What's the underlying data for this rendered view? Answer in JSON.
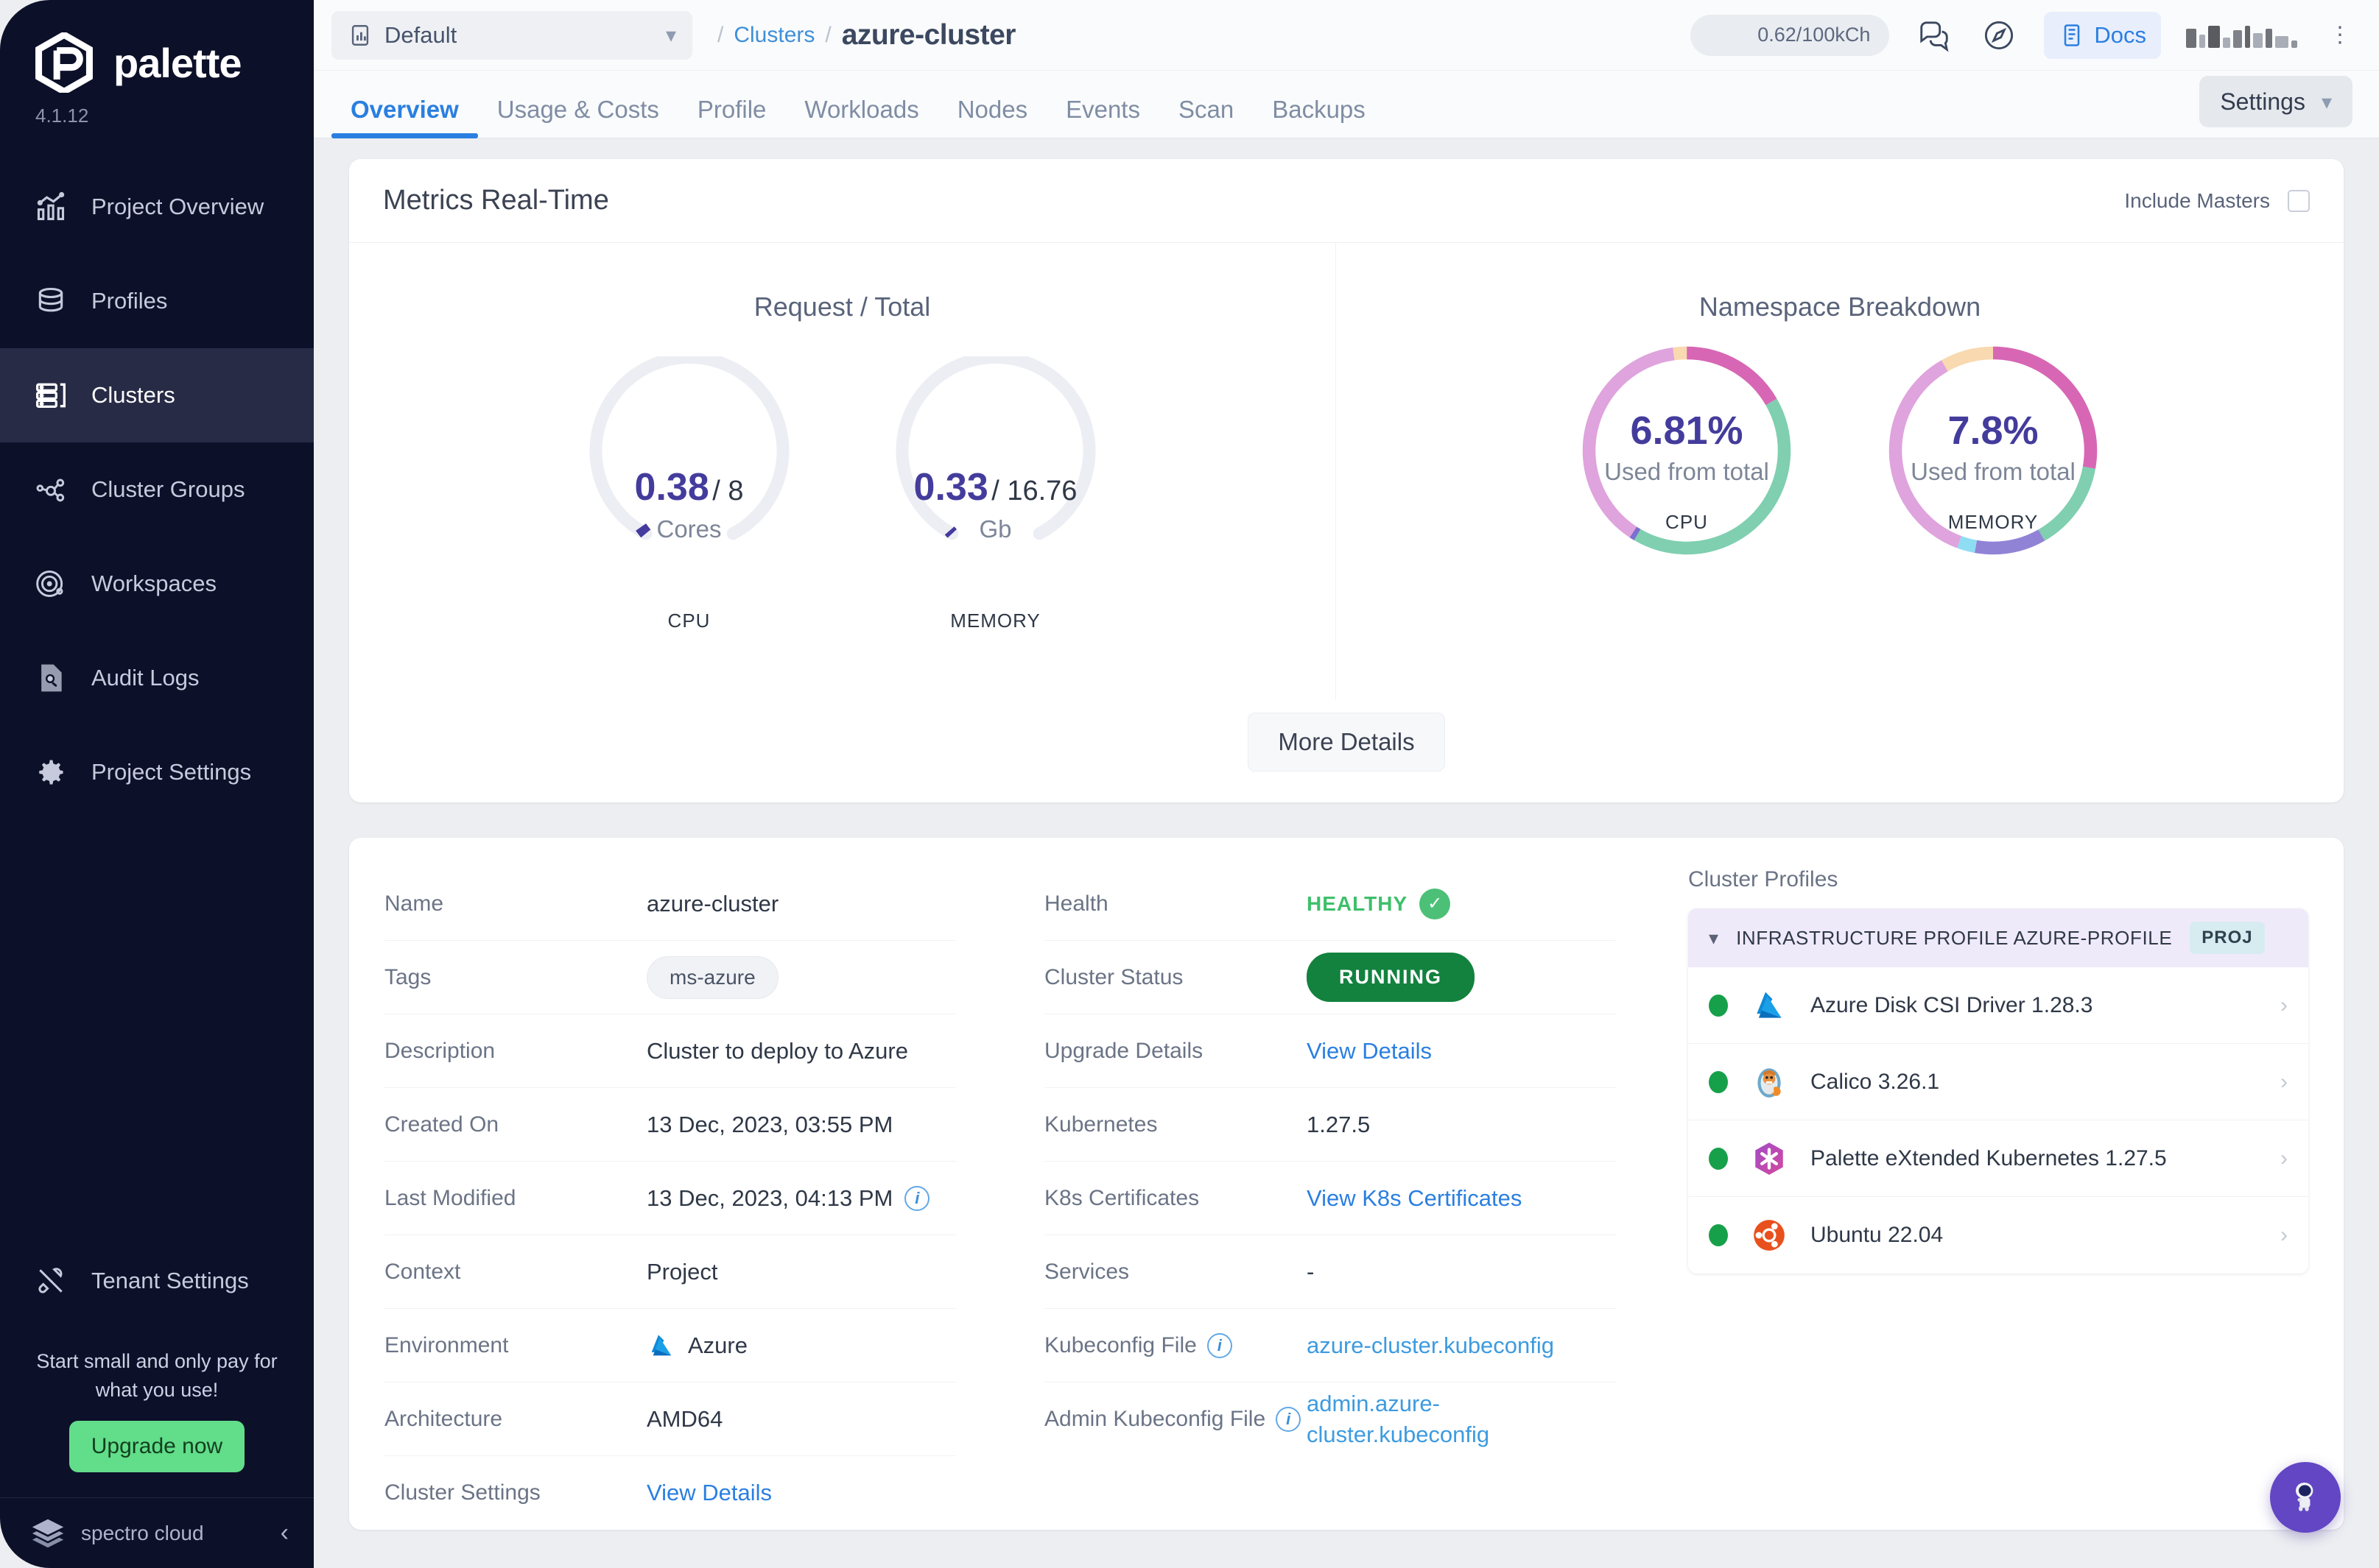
{
  "sidebar": {
    "brand": "palette",
    "version": "4.1.12",
    "items": [
      {
        "label": "Project Overview",
        "icon": "chart-bars-icon"
      },
      {
        "label": "Profiles",
        "icon": "stack-icon"
      },
      {
        "label": "Clusters",
        "icon": "server-rack-icon"
      },
      {
        "label": "Cluster Groups",
        "icon": "nodes-graph-icon"
      },
      {
        "label": "Workspaces",
        "icon": "orbit-icon"
      },
      {
        "label": "Audit Logs",
        "icon": "document-search-icon"
      },
      {
        "label": "Project Settings",
        "icon": "gear-icon"
      }
    ],
    "active_item": "Clusters",
    "tenant_settings": "Tenant Settings",
    "promo_text": "Start small and only pay for what you use!",
    "promo_button": "Upgrade now",
    "footer_brand": "spectro cloud"
  },
  "topbar": {
    "project": "Default",
    "breadcrumb_parent": "Clusters",
    "breadcrumb_current": "azure-cluster",
    "credits": "0.62/100kCh",
    "docs": "Docs"
  },
  "tabs": [
    {
      "label": "Overview",
      "active": true
    },
    {
      "label": "Usage & Costs",
      "active": false
    },
    {
      "label": "Profile",
      "active": false
    },
    {
      "label": "Workloads",
      "active": false
    },
    {
      "label": "Nodes",
      "active": false
    },
    {
      "label": "Events",
      "active": false
    },
    {
      "label": "Scan",
      "active": false
    },
    {
      "label": "Backups",
      "active": false
    }
  ],
  "settings_button": "Settings",
  "metrics": {
    "title": "Metrics Real-Time",
    "include_masters_label": "Include Masters",
    "include_masters_checked": false,
    "left_panel_title": "Request / Total",
    "right_panel_title": "Namespace Breakdown",
    "more_details": "More Details"
  },
  "chart_data": [
    {
      "type": "gauge",
      "title": "Request / Total",
      "id": "cpu-gauge",
      "label": "CPU",
      "unit": "Cores",
      "value": 0.38,
      "total": 8,
      "value_text": "0.38",
      "total_text": "/ 8",
      "fraction": 0.0475,
      "arc_span_degrees": 270,
      "track_color": "#eceef4",
      "fill_color": "#453a9e"
    },
    {
      "type": "gauge",
      "title": "Request / Total",
      "id": "memory-gauge",
      "label": "MEMORY",
      "unit": "Gb",
      "value": 0.33,
      "total": 16.76,
      "value_text": "0.33",
      "total_text": "/ 16.76",
      "fraction": 0.0197,
      "arc_span_degrees": 270,
      "track_color": "#eceef4",
      "fill_color": "#453a9e"
    },
    {
      "type": "pie",
      "title": "Namespace Breakdown",
      "id": "cpu-namespace-donut",
      "label": "CPU",
      "center_value": "6.81%",
      "center_sub": "Used from total",
      "segments": [
        {
          "name": "segment-magenta",
          "value": 16.7,
          "color": "#d767b4"
        },
        {
          "name": "segment-teal",
          "value": 41.7,
          "color": "#7fcfb0"
        },
        {
          "name": "segment-violet",
          "value": 0.8,
          "color": "#7b6fd0"
        },
        {
          "name": "segment-orchid",
          "value": 38.6,
          "color": "#dfa3dd"
        },
        {
          "name": "segment-peach",
          "value": 2.2,
          "color": "#f8d9b0"
        }
      ]
    },
    {
      "type": "pie",
      "title": "Namespace Breakdown",
      "id": "memory-namespace-donut",
      "label": "MEMORY",
      "center_value": "7.8%",
      "center_sub": "Used from total",
      "segments": [
        {
          "name": "segment-magenta",
          "value": 27.8,
          "color": "#d767b4"
        },
        {
          "name": "segment-teal",
          "value": 13.9,
          "color": "#7fcfb0"
        },
        {
          "name": "segment-violet",
          "value": 11.1,
          "color": "#9083d6"
        },
        {
          "name": "segment-cyan",
          "value": 2.8,
          "color": "#8fddf2"
        },
        {
          "name": "segment-orchid",
          "value": 36.1,
          "color": "#dfa3dd"
        },
        {
          "name": "segment-peach",
          "value": 8.3,
          "color": "#f8d9b0"
        }
      ]
    }
  ],
  "details_left": [
    {
      "label": "Name",
      "value": "azure-cluster",
      "kind": "text"
    },
    {
      "label": "Tags",
      "value": "ms-azure",
      "kind": "tag"
    },
    {
      "label": "Description",
      "value": "Cluster to deploy to Azure",
      "kind": "text"
    },
    {
      "label": "Created On",
      "value": "13 Dec, 2023, 03:55 PM",
      "kind": "text"
    },
    {
      "label": "Last Modified",
      "value": "13 Dec, 2023, 04:13 PM",
      "kind": "text-info"
    },
    {
      "label": "Context",
      "value": "Project",
      "kind": "text"
    },
    {
      "label": "Environment",
      "value": "Azure",
      "kind": "azure"
    },
    {
      "label": "Architecture",
      "value": "AMD64",
      "kind": "text"
    },
    {
      "label": "Cluster Settings",
      "value": "View Details",
      "kind": "link"
    }
  ],
  "details_mid": [
    {
      "label": "Health",
      "value": "HEALTHY",
      "kind": "health"
    },
    {
      "label": "Cluster Status",
      "value": "RUNNING",
      "kind": "status"
    },
    {
      "label": "Upgrade Details",
      "value": "View Details",
      "kind": "link"
    },
    {
      "label": "Kubernetes",
      "value": "1.27.5",
      "kind": "text"
    },
    {
      "label": "K8s Certificates",
      "value": "View K8s Certificates",
      "kind": "link"
    },
    {
      "label": "Services",
      "value": "-",
      "kind": "text"
    },
    {
      "label": "Kubeconfig File",
      "value": "azure-cluster.kubeconfig",
      "kind": "link-info"
    },
    {
      "label": "Admin Kubeconfig File",
      "value": "admin.azure-cluster.kubeconfig",
      "kind": "link-info"
    }
  ],
  "cluster_profiles": {
    "title": "Cluster Profiles",
    "group_label": "INFRASTRUCTURE PROFILE AZURE-PROFILE",
    "group_badge": "PROJ",
    "layers": [
      {
        "name": "Azure Disk CSI Driver 1.28.3",
        "status_color": "#17a04a",
        "icon": "azure-icon"
      },
      {
        "name": "Calico 3.26.1",
        "status_color": "#17a04a",
        "icon": "calico-icon"
      },
      {
        "name": "Palette eXtended Kubernetes 1.27.5",
        "status_color": "#17a04a",
        "icon": "palette-k8s-icon"
      },
      {
        "name": "Ubuntu 22.04",
        "status_color": "#17a04a",
        "icon": "ubuntu-icon"
      }
    ]
  },
  "colors": {
    "accent_blue": "#2a7fe0",
    "sidebar_bg": "#0d1029",
    "status_green": "#12823e",
    "health_green": "#3fbf6b",
    "gauge_purple": "#453a9e",
    "upgrade_green": "#62dd8a",
    "fab_purple": "#6246c4"
  }
}
